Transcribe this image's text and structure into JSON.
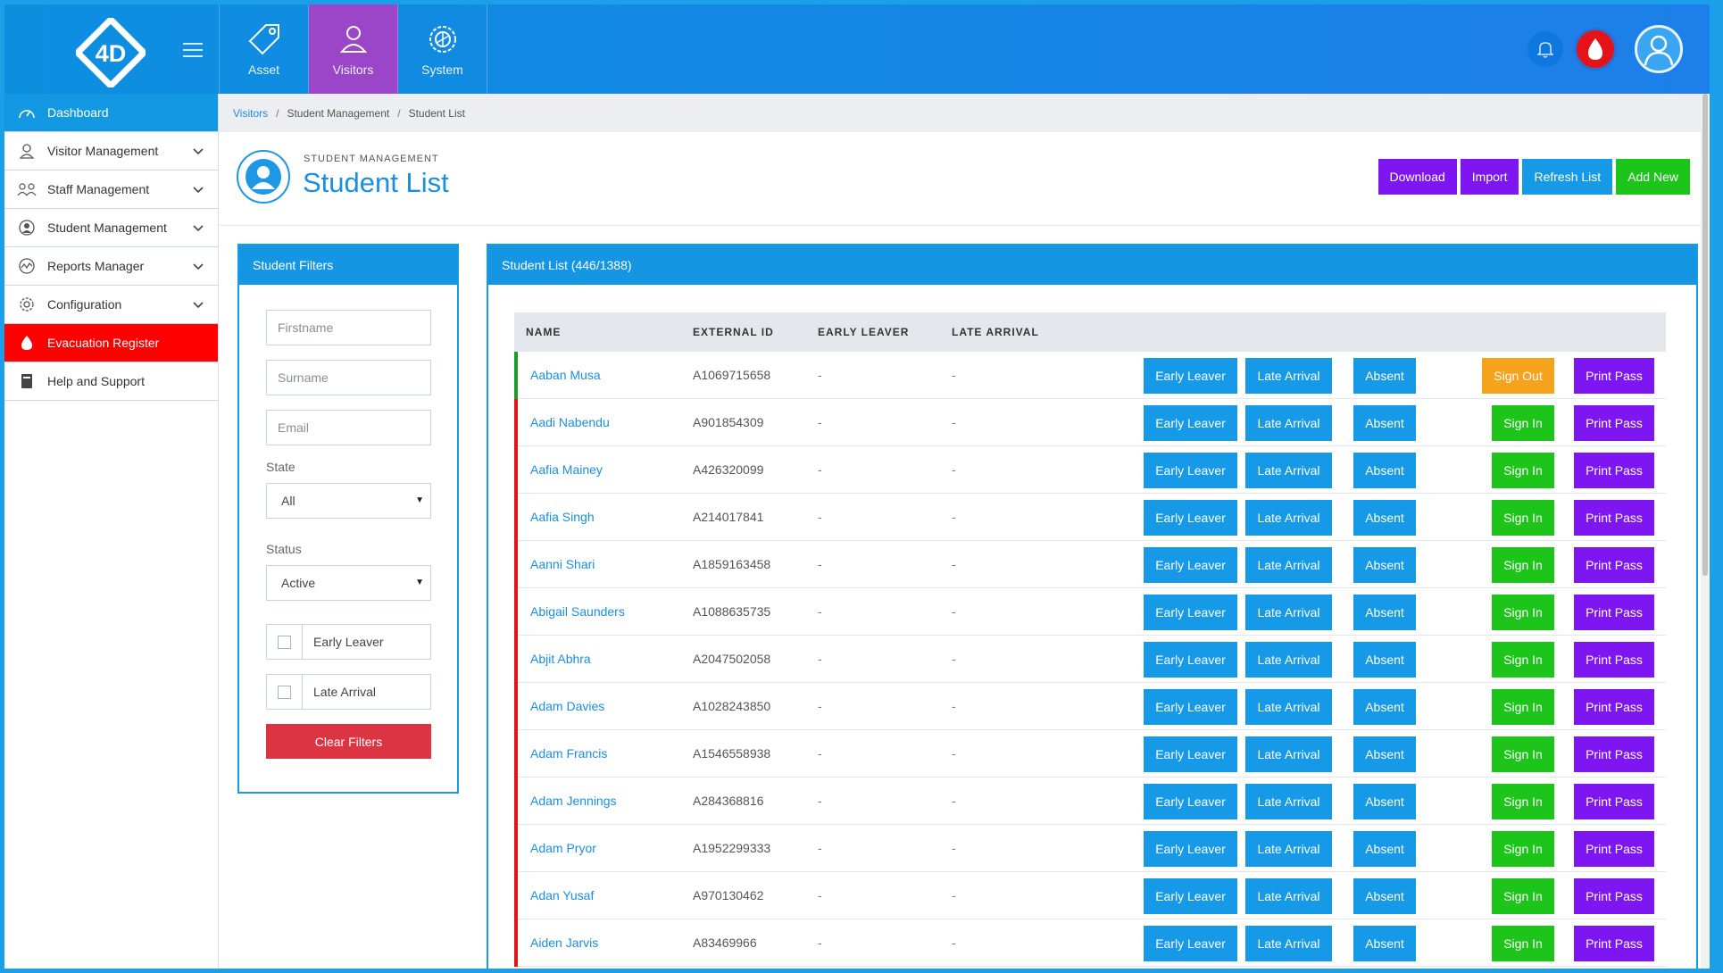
{
  "colors": {
    "accent": "#1496e3",
    "visitors_active": "#9b45c8",
    "evacuation": "#ff0000",
    "download": "#7d16f0",
    "import": "#7d16f0",
    "refresh": "#1699e6",
    "add_new": "#1dc51b",
    "sign_in": "#1dc51b",
    "sign_out": "#f5a21c",
    "print_pass": "#7d16f0",
    "clear_filters": "#dd3444",
    "signed_in_bar": "#1c9c2a",
    "signed_out_bar": "#e3151b"
  },
  "topnav": [
    {
      "label": "Asset",
      "icon": "tag-icon"
    },
    {
      "label": "Visitors",
      "icon": "person-icon"
    },
    {
      "label": "System",
      "icon": "gear-icon"
    }
  ],
  "sidebar": {
    "items": [
      {
        "label": "Dashboard",
        "icon": "speedometer-icon"
      },
      {
        "label": "Visitor Management",
        "icon": "visitor-icon"
      },
      {
        "label": "Staff Management",
        "icon": "staff-icon"
      },
      {
        "label": "Student Management",
        "icon": "student-icon"
      },
      {
        "label": "Reports Manager",
        "icon": "chart-line-icon"
      },
      {
        "label": "Configuration",
        "icon": "gear-icon"
      },
      {
        "label": "Evacuation Register",
        "icon": "flame-icon"
      },
      {
        "label": "Help and Support",
        "icon": "book-icon"
      }
    ]
  },
  "breadcrumb": [
    "Visitors",
    "Student Management",
    "Student List"
  ],
  "header": {
    "subtitle": "STUDENT MANAGEMENT",
    "title": "Student List"
  },
  "header_buttons": {
    "download": "Download",
    "import": "Import",
    "refresh": "Refresh List",
    "add_new": "Add New"
  },
  "filters": {
    "title": "Student Filters",
    "firstname_placeholder": "Firstname",
    "surname_placeholder": "Surname",
    "email_placeholder": "Email",
    "state_label": "State",
    "state_value": "All",
    "status_label": "Status",
    "status_value": "Active",
    "early_leaver": "Early Leaver",
    "late_arrival": "Late Arrival",
    "clear": "Clear Filters"
  },
  "list": {
    "title": "Student List (446/1388)",
    "columns": {
      "name": "NAME",
      "external_id": "EXTERNAL ID",
      "early_leaver": "EARLY LEAVER",
      "late_arrival": "LATE ARRIVAL"
    },
    "buttons": {
      "early_leaver": "Early Leaver",
      "late_arrival": "Late Arrival",
      "absent": "Absent",
      "sign_in": "Sign In",
      "sign_out": "Sign Out",
      "print_pass": "Print Pass"
    },
    "rows": [
      {
        "name": "Aaban Musa",
        "external_id": "A1069715658",
        "early_leaver": "-",
        "late_arrival": "-",
        "signed_in": true
      },
      {
        "name": "Aadi Nabendu",
        "external_id": "A901854309",
        "early_leaver": "-",
        "late_arrival": "-",
        "signed_in": false
      },
      {
        "name": "Aafia Mainey",
        "external_id": "A426320099",
        "early_leaver": "-",
        "late_arrival": "-",
        "signed_in": false
      },
      {
        "name": "Aafia Singh",
        "external_id": "A214017841",
        "early_leaver": "-",
        "late_arrival": "-",
        "signed_in": false
      },
      {
        "name": "Aanni Shari",
        "external_id": "A1859163458",
        "early_leaver": "-",
        "late_arrival": "-",
        "signed_in": false
      },
      {
        "name": "Abigail Saunders",
        "external_id": "A1088635735",
        "early_leaver": "-",
        "late_arrival": "-",
        "signed_in": false
      },
      {
        "name": "Abjit Abhra",
        "external_id": "A2047502058",
        "early_leaver": "-",
        "late_arrival": "-",
        "signed_in": false
      },
      {
        "name": "Adam Davies",
        "external_id": "A1028243850",
        "early_leaver": "-",
        "late_arrival": "-",
        "signed_in": false
      },
      {
        "name": "Adam Francis",
        "external_id": "A1546558938",
        "early_leaver": "-",
        "late_arrival": "-",
        "signed_in": false
      },
      {
        "name": "Adam Jennings",
        "external_id": "A284368816",
        "early_leaver": "-",
        "late_arrival": "-",
        "signed_in": false
      },
      {
        "name": "Adam Pryor",
        "external_id": "A1952299333",
        "early_leaver": "-",
        "late_arrival": "-",
        "signed_in": false
      },
      {
        "name": "Adan Yusaf",
        "external_id": "A970130462",
        "early_leaver": "-",
        "late_arrival": "-",
        "signed_in": false
      },
      {
        "name": "Aiden Jarvis",
        "external_id": "A83469966",
        "early_leaver": "-",
        "late_arrival": "-",
        "signed_in": false
      }
    ]
  }
}
